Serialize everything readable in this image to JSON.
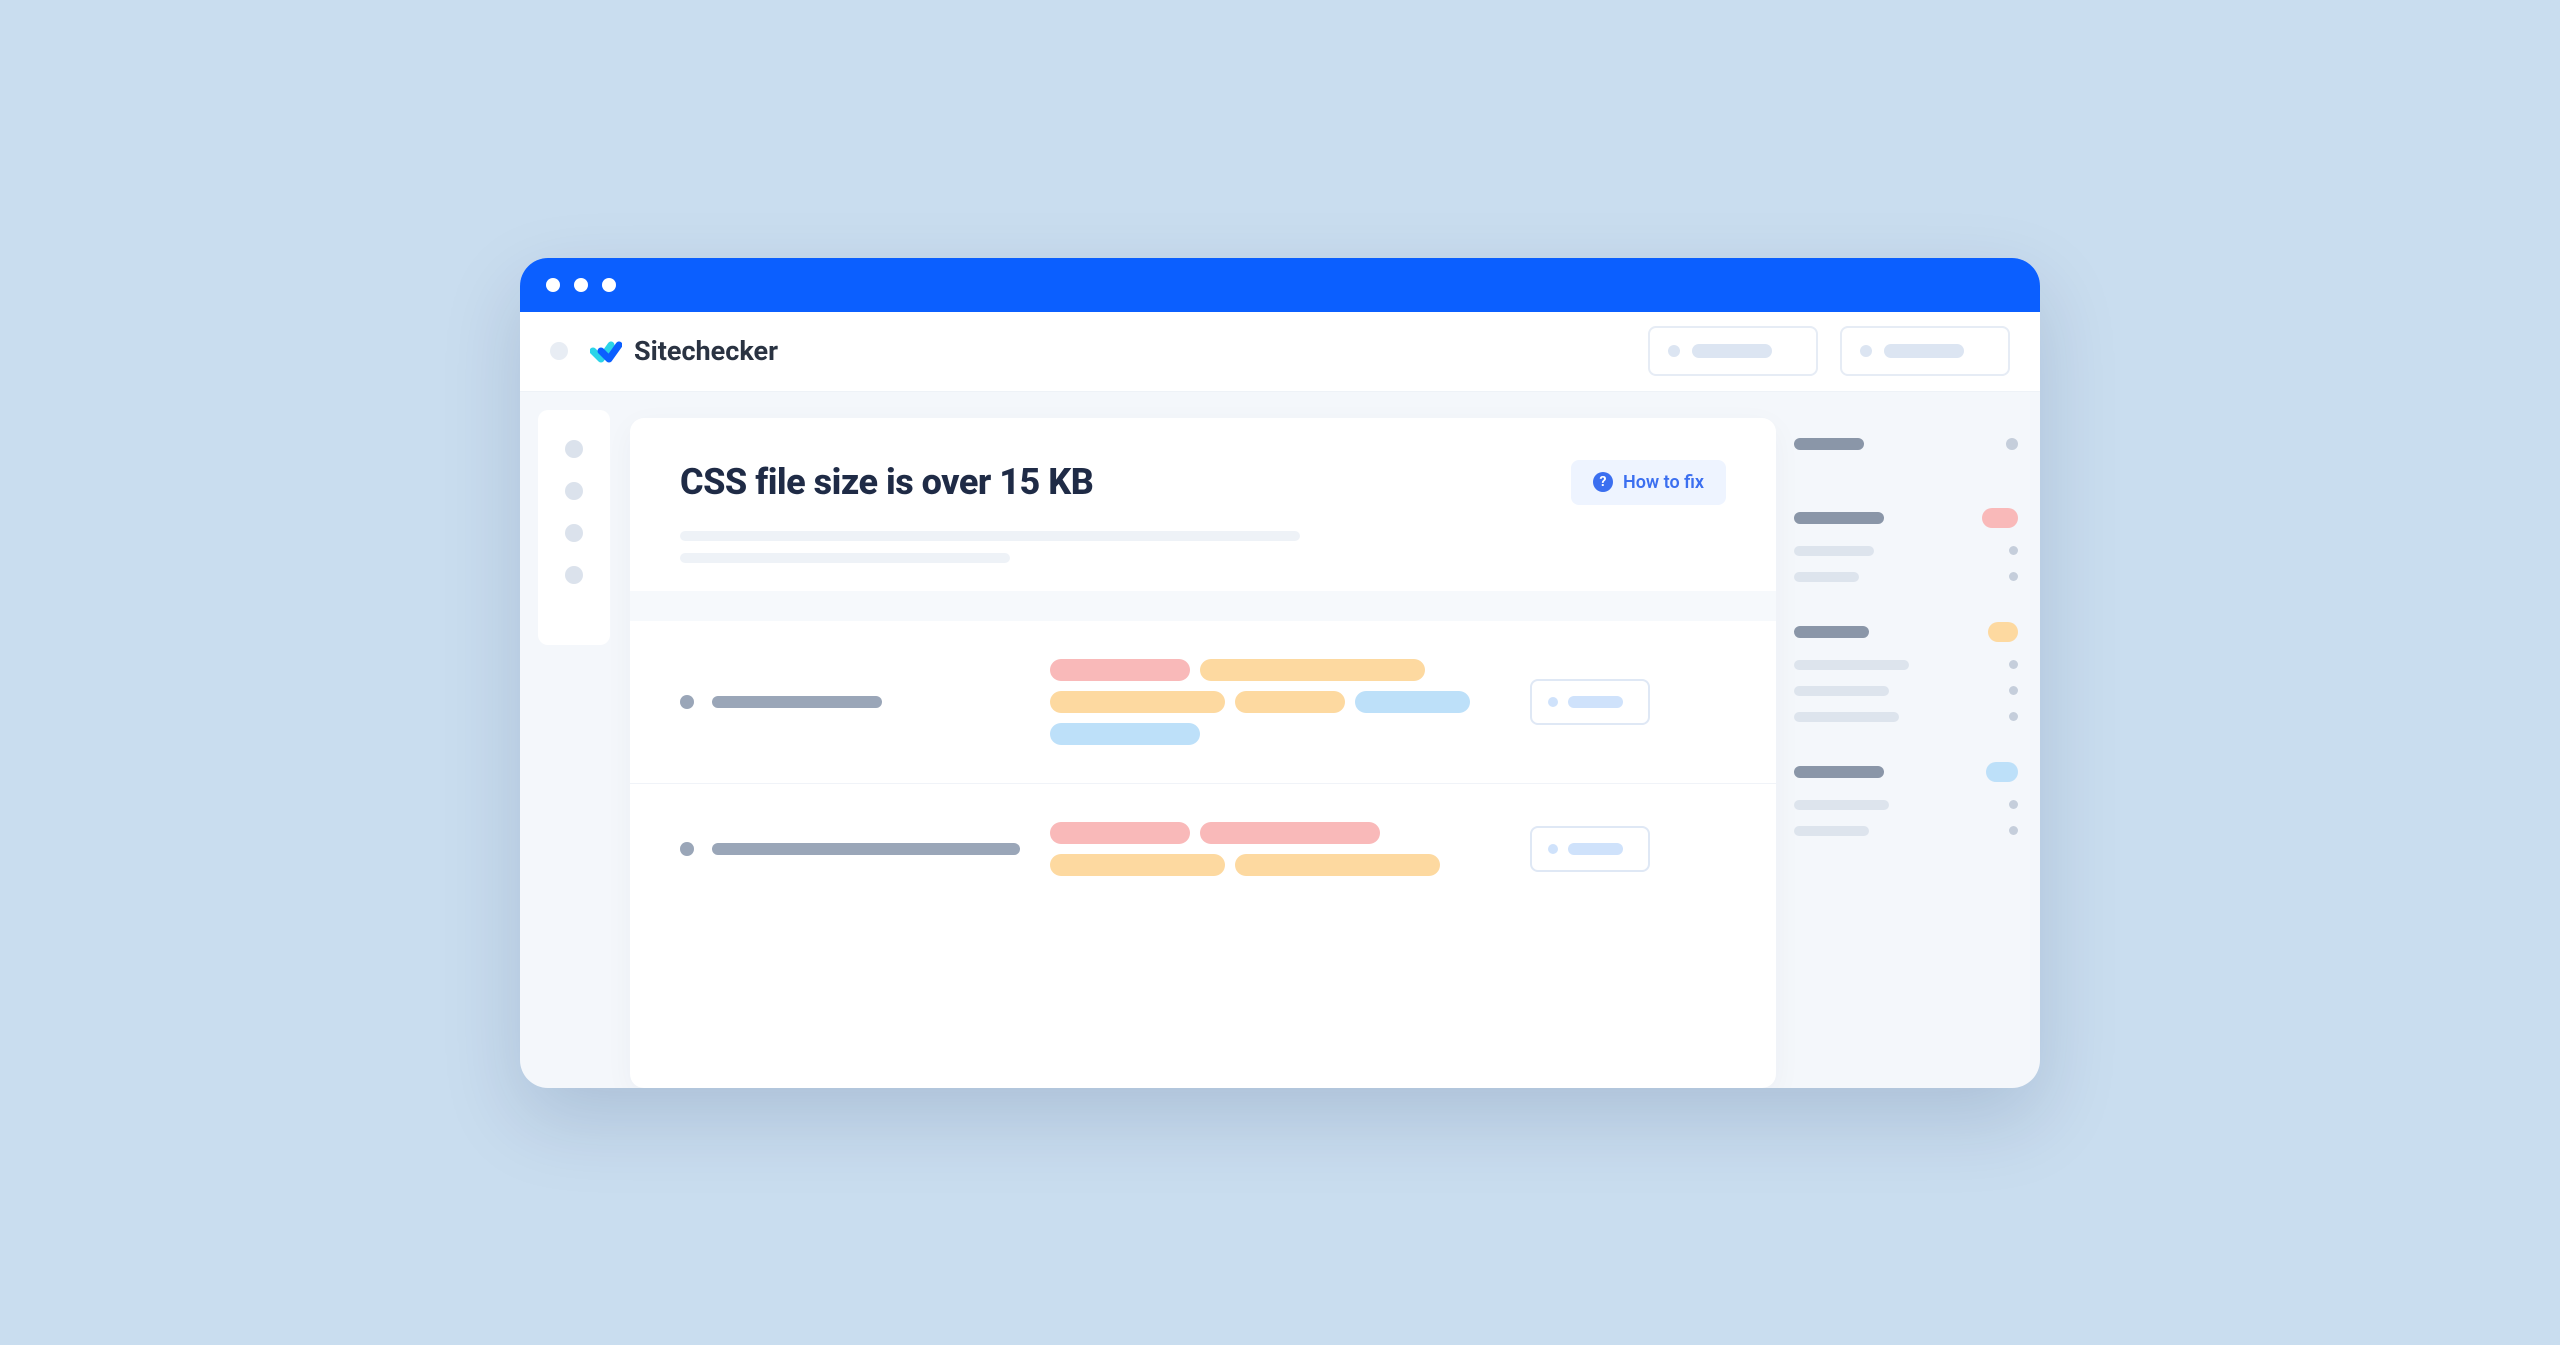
{
  "brand": {
    "name": "Sitechecker"
  },
  "issue": {
    "title": "CSS file size is over 15 KB",
    "howto_label": "How to fix"
  },
  "colors": {
    "accent": "#0B5FFF",
    "tag_red": "#f9b9b9",
    "tag_orange": "#fdd9a0",
    "tag_blue": "#bde0f9"
  }
}
